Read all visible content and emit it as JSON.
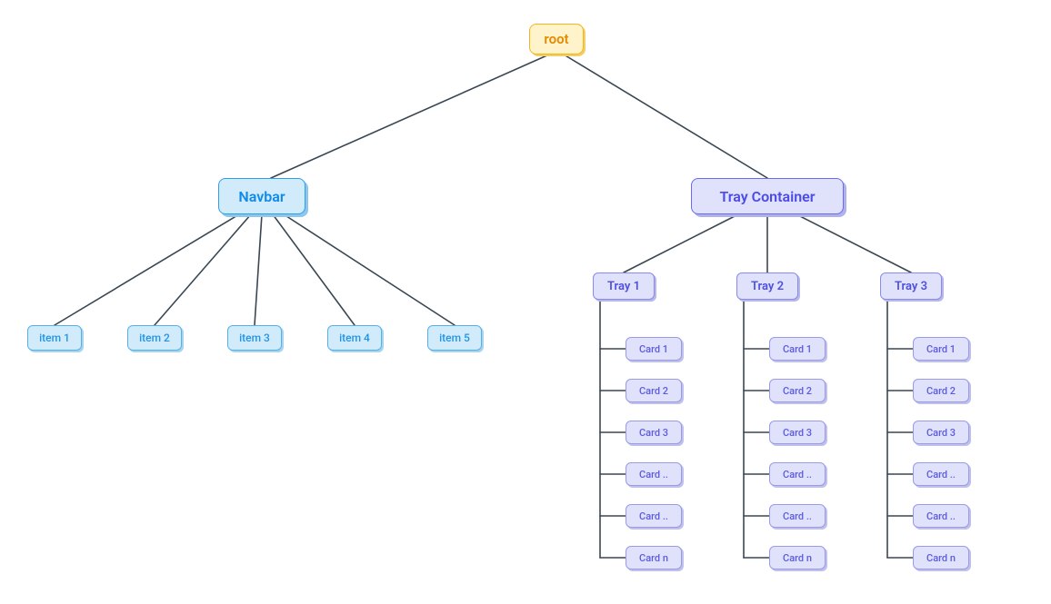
{
  "root": {
    "label": "root"
  },
  "navbar": {
    "label": "Navbar",
    "items": [
      {
        "label": "item 1"
      },
      {
        "label": "item 2"
      },
      {
        "label": "item 3"
      },
      {
        "label": "item 4"
      },
      {
        "label": "item 5"
      }
    ]
  },
  "tray_container": {
    "label": "Tray Container",
    "trays": [
      {
        "label": "Tray 1",
        "cards": [
          {
            "label": "Card 1"
          },
          {
            "label": "Card 2"
          },
          {
            "label": "Card 3"
          },
          {
            "label": "Card .."
          },
          {
            "label": "Card .."
          },
          {
            "label": "Card n"
          }
        ]
      },
      {
        "label": "Tray 2",
        "cards": [
          {
            "label": "Card 1"
          },
          {
            "label": "Card 2"
          },
          {
            "label": "Card 3"
          },
          {
            "label": "Card .."
          },
          {
            "label": "Card .."
          },
          {
            "label": "Card n"
          }
        ]
      },
      {
        "label": "Tray 3",
        "cards": [
          {
            "label": "Card 1"
          },
          {
            "label": "Card 2"
          },
          {
            "label": "Card 3"
          },
          {
            "label": "Card .."
          },
          {
            "label": "Card .."
          },
          {
            "label": "Card n"
          }
        ]
      }
    ]
  },
  "colors": {
    "edge": "#3A4752",
    "root_bg": "#FFF3CC",
    "root_border": "#F1B61E",
    "root_text": "#E38B00",
    "blue_bg": "#D2EBFB",
    "blue_border": "#2F9EEA",
    "blue_text": "#0D8AEA",
    "purple_bg": "#E0E1FB",
    "purple_border": "#6B6BF0",
    "purple_text": "#4B4BE6"
  }
}
